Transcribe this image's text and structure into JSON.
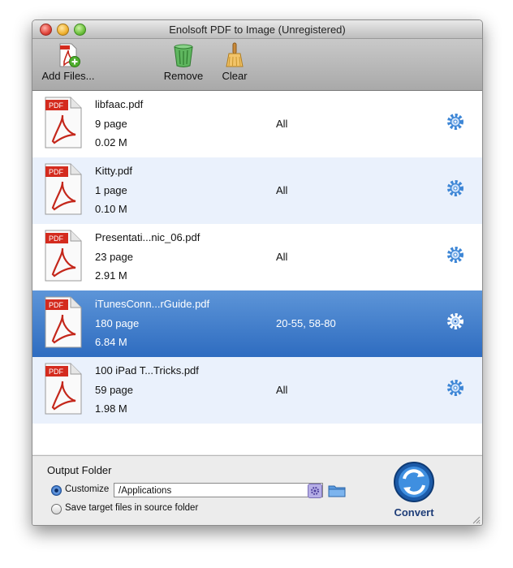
{
  "window": {
    "title": "Enolsoft PDF to Image (Unregistered)"
  },
  "toolbar": {
    "add_files": {
      "label": "Add Files...",
      "icon": "pdf-add-icon"
    },
    "remove": {
      "label": "Remove",
      "icon": "trash-icon"
    },
    "clear": {
      "label": "Clear",
      "icon": "broom-icon"
    }
  },
  "files": [
    {
      "name": "libfaac.pdf",
      "pages": "9 page",
      "size": "0.02 M",
      "range": "All",
      "selected": false
    },
    {
      "name": "Kitty.pdf",
      "pages": "1 page",
      "size": "0.10 M",
      "range": "All",
      "selected": false
    },
    {
      "name": "Presentati...nic_06.pdf",
      "pages": "23 page",
      "size": "2.91 M",
      "range": "All",
      "selected": false
    },
    {
      "name": "iTunesConn...rGuide.pdf",
      "pages": "180 page",
      "size": "6.84 M",
      "range": "20-55, 58-80",
      "selected": true
    },
    {
      "name": "100 iPad T...Tricks.pdf",
      "pages": "59 page",
      "size": "1.98 M",
      "range": "All",
      "selected": false
    }
  ],
  "output": {
    "label": "Output Folder",
    "customize_label": "Customize",
    "path": "/Applications",
    "source_label": "Save target files in source folder",
    "selected_option": "Customize"
  },
  "convert": {
    "label": "Convert"
  },
  "colors": {
    "selection": "#2e6cc0",
    "alt_row": "#eaf1fc",
    "accent": "#1e5fb5"
  }
}
